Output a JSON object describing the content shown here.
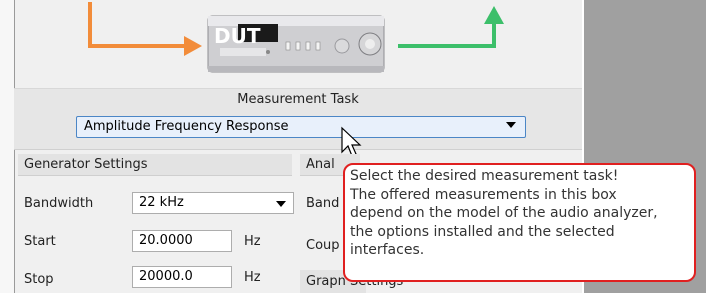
{
  "device": {
    "name": "DUT",
    "input_arrow_color": "#f28c3a",
    "output_arrow_color": "#3cbf6a"
  },
  "measurement": {
    "label": "Measurement Task",
    "selected": "Amplitude Frequency Response"
  },
  "generator": {
    "title": "Generator Settings",
    "rows": [
      {
        "label": "Bandwidth",
        "value": "22 kHz",
        "unit": ""
      },
      {
        "label": "Start",
        "value": "20.0000",
        "unit": "Hz"
      },
      {
        "label": "Stop",
        "value": "20000.0",
        "unit": "Hz"
      }
    ]
  },
  "analyzer": {
    "title_partial": "Anal",
    "row1_partial": "Band",
    "row2_partial": "Coup",
    "graph_partial": "Grapn Settings"
  },
  "tooltip": {
    "lines": [
      "Select the desired measurement task!",
      "The offered measurements in this box",
      "depend on the model of the audio analyzer,",
      "the options installed and the selected",
      "interfaces."
    ],
    "border_color": "#e02020"
  }
}
